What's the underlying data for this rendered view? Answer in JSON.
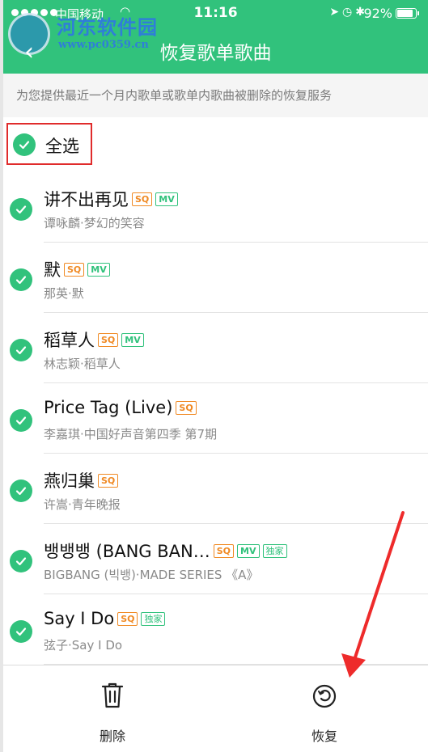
{
  "status_bar": {
    "carrier": "中国移动",
    "time": "11:16",
    "battery": "92%",
    "battery_level": 0.92
  },
  "header": {
    "title": "恢复歌单歌曲",
    "back_icon": "chevron-left-icon",
    "accent_color": "#31c27c"
  },
  "watermark": {
    "name": "河东软件园",
    "url": "www.pc0359.cn"
  },
  "notice": "为您提供最近一个月内歌单或歌单内歌曲被删除的恢复服务",
  "select_all": {
    "label": "全选",
    "checked": true
  },
  "songs": [
    {
      "title": "讲不出再见",
      "subtitle": "谭咏麟·梦幻的笑容",
      "tags": [
        "SQ",
        "MV"
      ],
      "checked": true
    },
    {
      "title": "默",
      "subtitle": "那英·默",
      "tags": [
        "SQ",
        "MV"
      ],
      "checked": true
    },
    {
      "title": "稻草人",
      "subtitle": "林志颖·稻草人",
      "tags": [
        "SQ",
        "MV"
      ],
      "checked": true
    },
    {
      "title": "Price Tag (Live)",
      "subtitle": "李嘉琪·中国好声音第四季 第7期",
      "tags": [
        "SQ"
      ],
      "checked": true
    },
    {
      "title": "燕归巢",
      "subtitle": "许嵩·青年晚报",
      "tags": [
        "SQ"
      ],
      "checked": true
    },
    {
      "title": "뱅뱅뱅 (BANG BAN…",
      "subtitle": "BIGBANG (빅뱅)·MADE SERIES 《A》",
      "tags": [
        "SQ",
        "MV",
        "独家"
      ],
      "checked": true
    },
    {
      "title": "Say I Do",
      "subtitle": "弦子·Say I Do",
      "tags": [
        "SQ",
        "独家"
      ],
      "checked": true
    }
  ],
  "actions": {
    "delete_label": "删除",
    "restore_label": "恢复",
    "delete_icon": "trash-icon",
    "restore_icon": "restore-icon"
  },
  "colors": {
    "tag_sq": "#f08a24",
    "tag_mv": "#31c27c",
    "highlight_box": "#e02b2b"
  }
}
